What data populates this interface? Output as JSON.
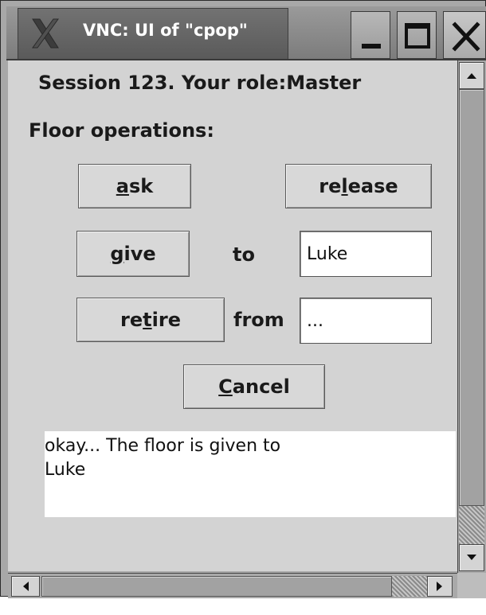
{
  "window": {
    "title": "VNC: UI of \"cpop\"",
    "controls": {
      "minimize": "minimize-icon",
      "maximize": "maximize-icon",
      "close": "close-icon"
    }
  },
  "session": {
    "prefix": "Session 123. Your role:",
    "role": "Master"
  },
  "floor": {
    "label": "Floor operations:",
    "ask": {
      "pre": "",
      "acc": "a",
      "post": "sk"
    },
    "release": {
      "pre": "re",
      "acc": "l",
      "post": "ease"
    },
    "give": {
      "pre": "",
      "acc": "g",
      "post": "ive"
    },
    "retire": {
      "pre": "re",
      "acc": "t",
      "post": "ire"
    },
    "cancel": {
      "pre": "",
      "acc": "C",
      "post": "ancel"
    },
    "to_label": "to",
    "from_label": "from",
    "give_to_value": "Luke",
    "retire_from_value": "..."
  },
  "message": {
    "line1": "okay... The floor is given to",
    "line2": "Luke"
  },
  "colors": {
    "window_bg": "#d3d3d3",
    "titlebar": "#7c7c7c",
    "field_bg": "#ffffff"
  }
}
